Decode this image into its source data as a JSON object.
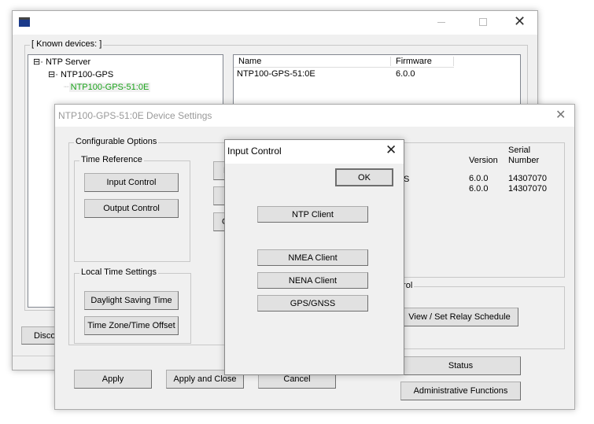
{
  "main_window": {
    "known_devices_label": "[ Known devices: ]",
    "tree": {
      "root": "NTP Server",
      "child": "NTP100-GPS",
      "leaf": "NTP100-GPS-51:0E"
    },
    "list": {
      "columns": [
        "Name",
        "Firmware"
      ],
      "rows": [
        [
          "NTP100-GPS-51:0E",
          "6.0.0"
        ]
      ]
    },
    "disco_button": "Disco",
    "leaf_color": "#1aa31a"
  },
  "device_settings": {
    "title": "NTP100-GPS-51:0E  Device Settings",
    "configurable_options": "Configurable Options",
    "time_reference": "Time Reference",
    "input_control": "Input Control",
    "output_control": "Output Control",
    "local_time_settings": "Local Time Settings",
    "daylight_saving": "Daylight Saving Time",
    "time_zone": "Time Zone/Time Offset",
    "mid_buttons": [
      "N",
      "",
      "O"
    ],
    "info": {
      "version_header": "Version",
      "serial_header_1": "Serial",
      "serial_header_2": "Number",
      "row_fragment": "S",
      "rows": [
        [
          "6.0.0",
          "14307070"
        ],
        [
          "6.0.0",
          "14307070"
        ]
      ]
    },
    "relay_label_fragment": "trol",
    "relay_button": "View / Set Relay Schedule",
    "apply": "Apply",
    "apply_close": "Apply and Close",
    "cancel": "Cancel",
    "status": "Status",
    "admin": "Administrative Functions"
  },
  "input_control_dialog": {
    "title": "Input Control",
    "ok": "OK",
    "buttons": [
      "NTP Client",
      "NMEA Client",
      "NENA Client",
      "GPS/GNSS"
    ]
  }
}
